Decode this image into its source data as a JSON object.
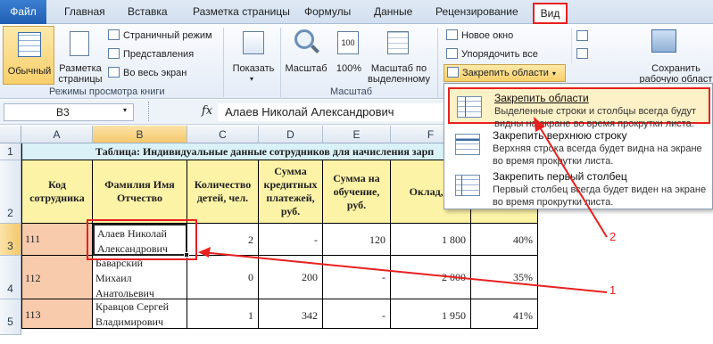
{
  "ribbon_tabs": {
    "file": "Файл",
    "home": "Главная",
    "insert": "Вставка",
    "page_layout": "Разметка страницы",
    "formulas": "Формулы",
    "data": "Данные",
    "review": "Рецензирование",
    "view": "Вид"
  },
  "workbook_views": {
    "normal": "Обычный",
    "page_layout_1": "Разметка",
    "page_layout_2": "страницы",
    "page_break": "Страничный режим",
    "custom_views": "Представления",
    "full_screen": "Во весь экран",
    "group_label": "Режимы просмотра книги"
  },
  "show": {
    "label": "Показать"
  },
  "zoom": {
    "zoom": "Масштаб",
    "zoom100": "100%",
    "zoom_sel_1": "Масштаб по",
    "zoom_sel_2": "выделенному",
    "group_label": "Масштаб"
  },
  "window": {
    "new_window": "Новое окно",
    "arrange_all": "Упорядочить все",
    "freeze_panes": "Закрепить области",
    "save_ws_1": "Сохранить",
    "save_ws_2": "рабочую област"
  },
  "formula_bar": {
    "name_box": "B3",
    "fx": "fx",
    "formula": "Алаев Николай Александрович"
  },
  "columns": [
    "A",
    "B",
    "C",
    "D",
    "E",
    "F"
  ],
  "rows": [
    "1",
    "2",
    "3",
    "4",
    "5"
  ],
  "table": {
    "title": "Таблица: Индивидуальные данные сотрудников для начисления зарп",
    "headers": {
      "code": "Код сотрудника",
      "name": "Фамилия Имя Отчество",
      "children": "Количество детей, чел.",
      "credit": "Сумма кредитных платежей, руб.",
      "education": "Сумма на обучение, руб.",
      "salary": "Оклад, р"
    },
    "rows": [
      {
        "code": "111",
        "name_1": "Алаев Николай",
        "name_2": "Александрович",
        "children": "2",
        "credit": "-",
        "education": "120",
        "salary": "1 800",
        "pct": "40%"
      },
      {
        "code": "112",
        "name_1": "Баварский",
        "name_2": "Михаил",
        "name_3": "Анатольевич",
        "children": "0",
        "credit": "200",
        "education": "-",
        "salary": "2 000",
        "pct": "35%"
      },
      {
        "code": "113",
        "name_1": "Кравцов Сергей",
        "name_2": "Владимирович",
        "children": "1",
        "credit": "342",
        "education": "-",
        "salary": "1 950",
        "pct": "41%"
      }
    ]
  },
  "freeze_menu": [
    {
      "title": "Закрепить области",
      "desc": "Выделенные строки и столбцы всегда будут видны на экране во время прокрутки листа."
    },
    {
      "title": "Закрепить верхнюю строку",
      "desc": "Верхняя строка всегда будет видна на экране во время прокрутки листа."
    },
    {
      "title": "Закрепить первый столбец",
      "desc": "Первый столбец всегда будет виден на экране во время прокрутки листа."
    }
  ],
  "annotations": {
    "one": "1",
    "two": "2"
  },
  "colors": {
    "accent_red": "#e8201f",
    "header_yellow": "#fdf3a7",
    "code_peach": "#f8cbad"
  }
}
